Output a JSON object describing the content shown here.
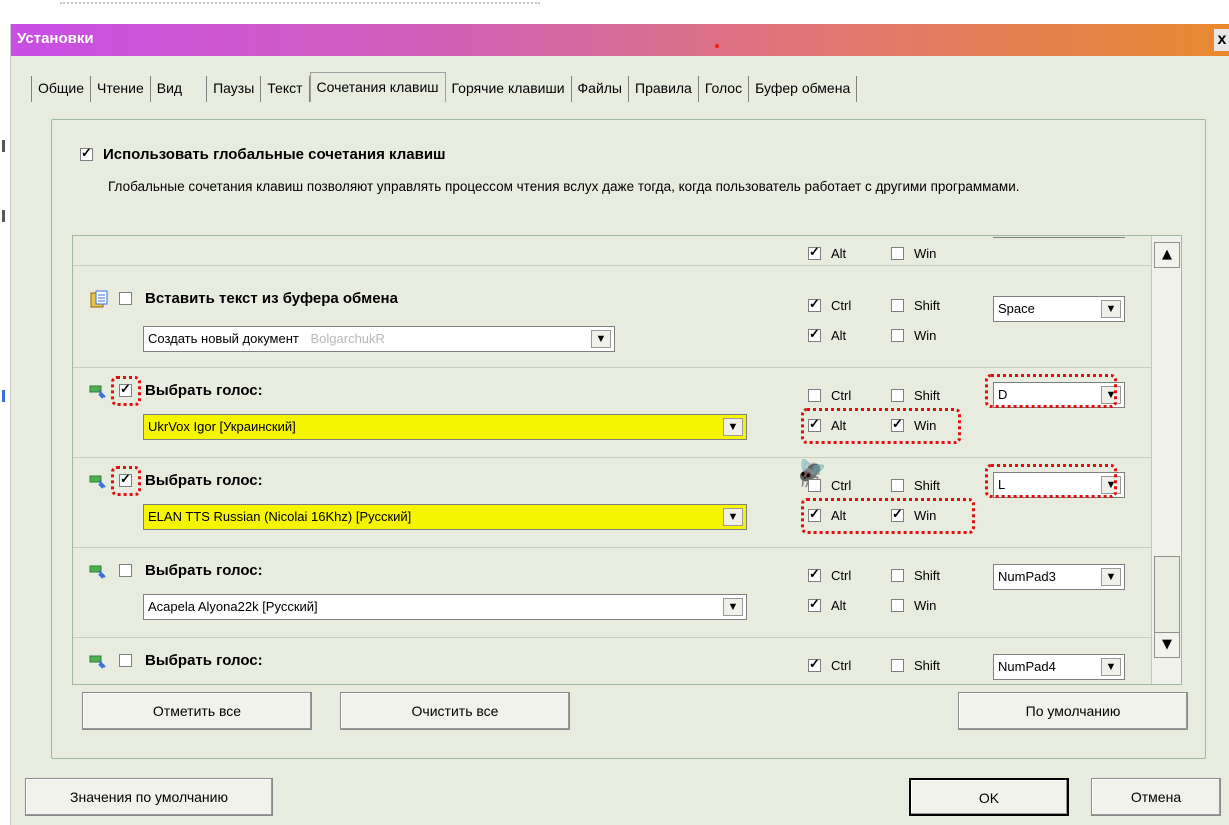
{
  "window": {
    "title": "Установки",
    "close": "x"
  },
  "tabs": [
    {
      "label": "Общие"
    },
    {
      "label": "Чтение"
    },
    {
      "label": "Вид"
    },
    {
      "label": "Паузы"
    },
    {
      "label": "Текст"
    },
    {
      "label": "Сочетания клавиш",
      "active": true
    },
    {
      "label": "Горячие клавиши"
    },
    {
      "label": "Файлы"
    },
    {
      "label": "Правила"
    },
    {
      "label": "Голос"
    },
    {
      "label": "Буфер обмена"
    }
  ],
  "global": {
    "label": "Использовать глобальные сочетания клавиш",
    "checked": true,
    "description": "Глобальные сочетания клавиш позволяют управлять процессом чтения вслух даже тогда, когда пользователь работает с другими программами."
  },
  "modifiers": {
    "ctrl": "Ctrl",
    "shift": "Shift",
    "alt": "Alt",
    "win": "Win"
  },
  "partial_row": {
    "alt": true,
    "win": false
  },
  "items": [
    {
      "label": "Вставить текст из буфера обмена",
      "enabled": false,
      "select": "Создать новый документ",
      "select_ghost": "BolgarchukR",
      "ctrl": true,
      "shift": false,
      "alt": true,
      "win": false,
      "key": "Space"
    },
    {
      "label": "Выбрать голос:",
      "enabled": true,
      "select": "UkrVox Igor [Украинский]",
      "ctrl": false,
      "shift": false,
      "alt": true,
      "win": true,
      "key": "D"
    },
    {
      "label": "Выбрать голос:",
      "enabled": true,
      "select": "ELAN TTS Russian (Nicolai 16Khz) [Русский]",
      "ctrl": false,
      "shift": false,
      "alt": true,
      "win": true,
      "key": "L"
    },
    {
      "label": "Выбрать голос:",
      "enabled": false,
      "select": "Acapela Alyona22k [Русский]",
      "ctrl": true,
      "shift": false,
      "alt": true,
      "win": false,
      "key": "NumPad3"
    },
    {
      "label": "Выбрать голос:",
      "enabled": false,
      "ctrl": true,
      "shift": false,
      "key": "NumPad4"
    }
  ],
  "buttons": {
    "check_all": "Отметить все",
    "clear_all": "Очистить все",
    "defaults_page": "По умолчанию",
    "defaults_all": "Значения по умолчанию",
    "ok": "OK",
    "cancel": "Отмена"
  }
}
